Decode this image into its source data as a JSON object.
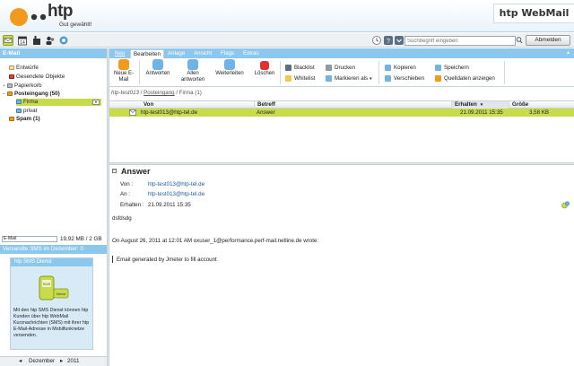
{
  "brand": {
    "logo_text": "htp",
    "slogan": "Gut gewählt!",
    "product": "htp WebMail",
    "colors": {
      "accent": "#8cc8ee",
      "selection": "#c8dc4a",
      "link": "#1b5c9c",
      "orange": "#f29a1d"
    }
  },
  "toolbar": {
    "search_placeholder": "Suchbegriff eingeben",
    "logout_label": "Abmelden",
    "icons": [
      "mail-icon",
      "calendar-icon",
      "phone-icon",
      "contacts-icon",
      "settings-icon"
    ]
  },
  "sidebar": {
    "header": "E-Mail",
    "folders": [
      {
        "label": "Entwürfe",
        "icon": "drafts-icon"
      },
      {
        "label": "Gesendete Objekte",
        "icon": "sent-icon"
      },
      {
        "label": "Papierkorb",
        "icon": "trash-icon"
      },
      {
        "label": "Posteingang (50)",
        "icon": "inbox-icon"
      },
      {
        "label": "Firma",
        "icon": "folder-icon"
      },
      {
        "label": "privat",
        "icon": "folder-icon"
      },
      {
        "label": "Spam (1)",
        "icon": "spam-icon"
      }
    ],
    "quota_bar_label": "E-Mail",
    "quota_text": "19,92 MB / 2 GB",
    "sms_sent": "Versandte SMS im Dezember: 0",
    "sms_box_title": "htp SMS Dienst",
    "sms_icon_label": "SMS Dienst",
    "sms_box_text": "Mit den htp SMS Dienst können htp Kunden über htp WebMail Kurznachrichten (SMS) mit ihrer htp E-Mail-Adresse in Mobilfunknetze versenden.",
    "calendar": {
      "prev": "◂",
      "month": "Dezember",
      "next": "▸",
      "year": "2011"
    }
  },
  "menu": {
    "tabs": [
      "Neu",
      "Bearbeiten",
      "Anlage",
      "Ansicht",
      "Flags",
      "Extras"
    ],
    "active": "Bearbeiten"
  },
  "ribbon": {
    "new_mail": "Neue E-Mail",
    "reply": "Antworten",
    "reply_all": "Allen antworten",
    "forward": "Weiterleiten",
    "delete": "Löschen",
    "blacklist": "Blacklist",
    "whitelist": "Whitelist",
    "print": "Drucken",
    "mark_as": "Markieren als",
    "copy": "Kopieren",
    "move": "Verschieben",
    "save": "Speichern",
    "source": "Quelldaten anzeigen"
  },
  "breadcrumb": {
    "account": "htp-test013",
    "inbox": "Posteingang",
    "folder": "Firma (1)"
  },
  "message_list": {
    "columns": [
      "Von",
      "Betreff",
      "Erhalten",
      "Größe"
    ],
    "rows": [
      {
        "from": "htp-test013@htp-tel.de",
        "subject": "Answer",
        "received": "21.09.2011 15:35",
        "size": "3,58 KB"
      }
    ]
  },
  "preview": {
    "subject": "Answer",
    "from_label": "Von :",
    "from": "htp-test013@htp-tel.de",
    "to_label": "An :",
    "to": "htp-test013@htp-tel.de",
    "received_label": "Erhalten :",
    "received": "21.09.2011 15:35",
    "body_line1": "dsfdsdg",
    "body_quote_header": "On August 26, 2011 at 12:01 AM oxuser_1@performance.perf-mail.netline.de wrote:",
    "body_quote": "Email generated by Jmeter to fill account"
  }
}
